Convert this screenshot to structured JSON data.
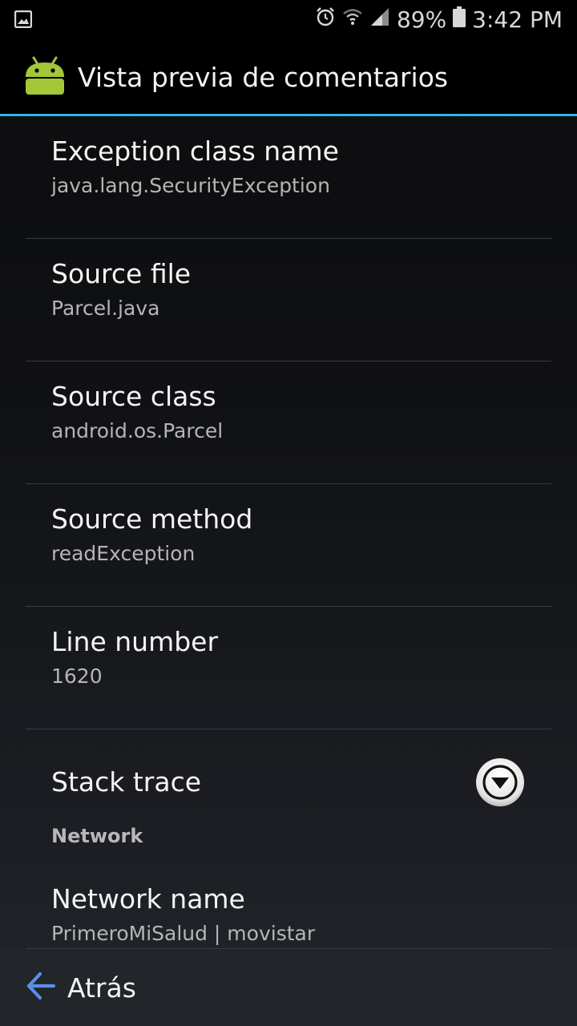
{
  "status_bar": {
    "battery_percent": "89%",
    "time": "3:42 PM",
    "icons": [
      "gallery-icon",
      "alarm-icon",
      "wifi-icon",
      "signal-icon",
      "battery-icon"
    ]
  },
  "action_bar": {
    "title": "Vista previa de comentarios",
    "app_icon": "android-icon",
    "divider_color": "#33b5e5"
  },
  "items": [
    {
      "label": "Exception class name",
      "value": "java.lang.SecurityException"
    },
    {
      "label": "Source file",
      "value": "Parcel.java"
    },
    {
      "label": "Source class",
      "value": "android.os.Parcel"
    },
    {
      "label": "Source method",
      "value": "readException"
    },
    {
      "label": "Line number",
      "value": "1620"
    }
  ],
  "stack_trace": {
    "label": "Stack trace",
    "toggle_icon": "chevron-down-circle-icon"
  },
  "network": {
    "section_title": "Network",
    "label": "Network name",
    "value": "PrimeroMiSalud | movistar"
  },
  "bottom_bar": {
    "back_label": "Atrás",
    "back_icon": "arrow-left-icon",
    "accent_color": "#5b8ee8"
  }
}
